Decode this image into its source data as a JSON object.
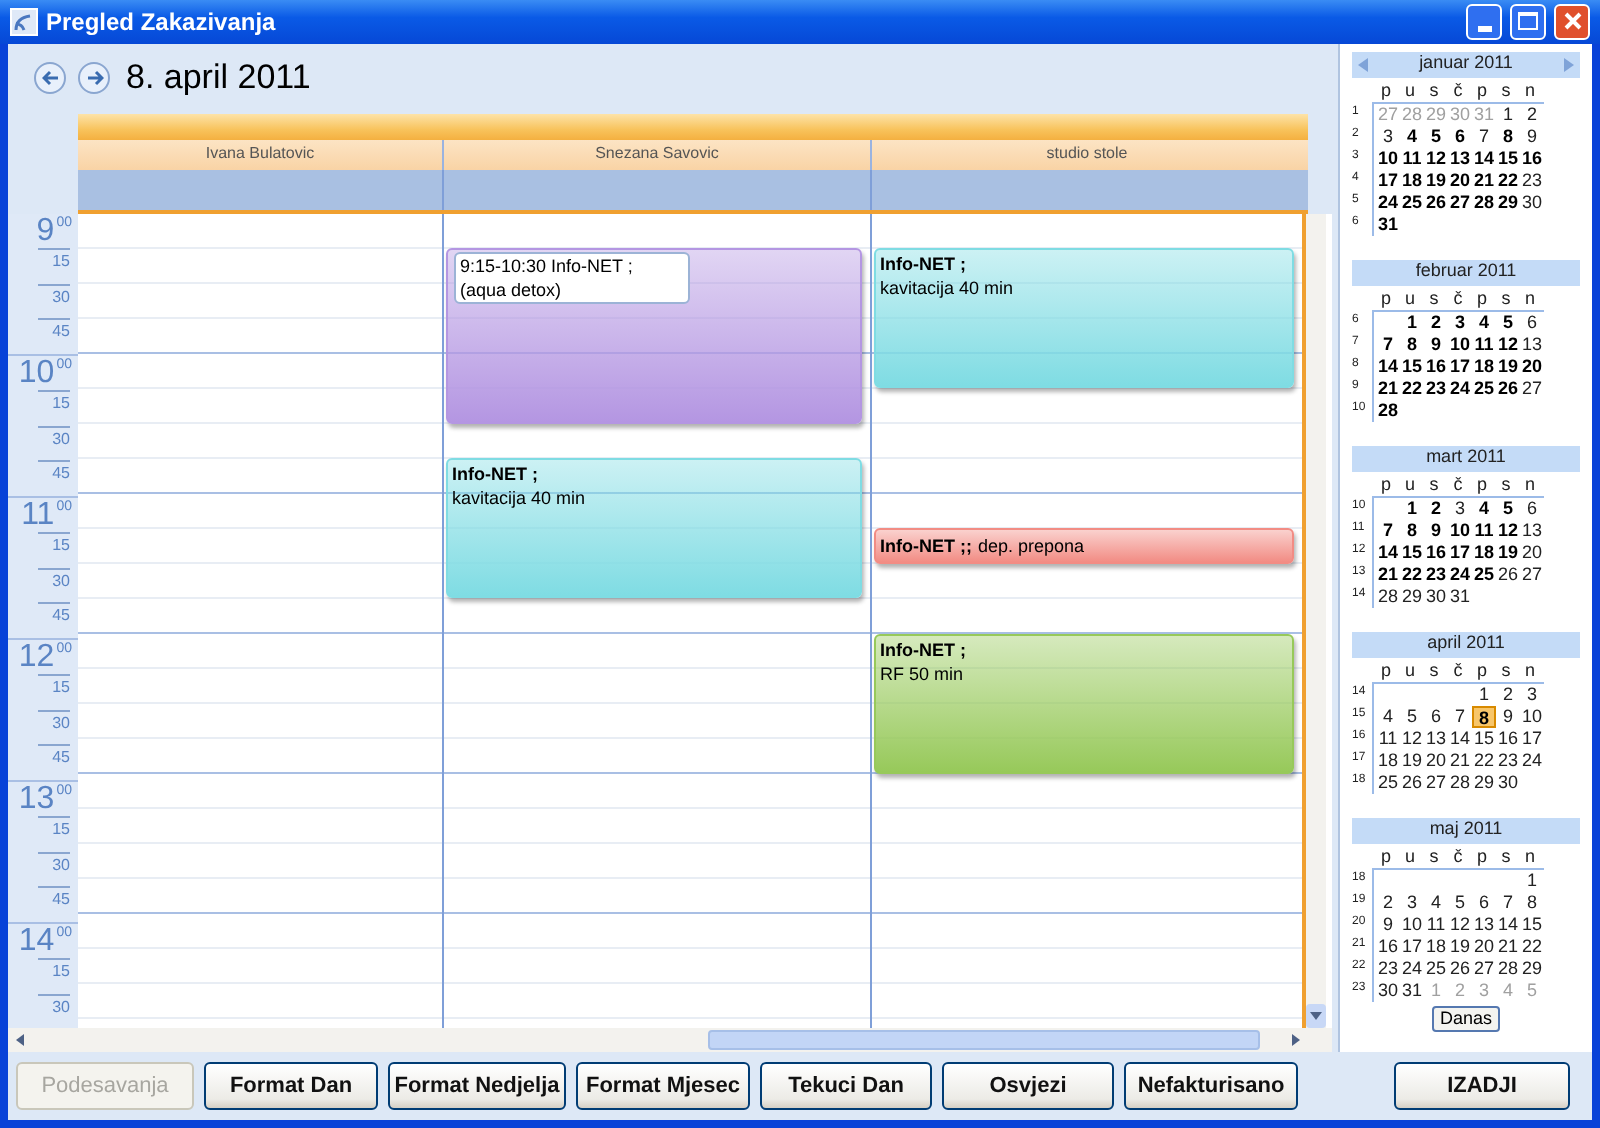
{
  "window": {
    "title": "Pregled Zakazivanja"
  },
  "date": "8. april 2011",
  "hours": [
    {
      "hour": "9",
      "minutes": "00",
      "quarters": [
        "15",
        "30",
        "45"
      ]
    },
    {
      "hour": "10",
      "minutes": "00",
      "quarters": [
        "15",
        "30",
        "45"
      ]
    },
    {
      "hour": "11",
      "minutes": "00",
      "quarters": [
        "15",
        "30",
        "45"
      ]
    },
    {
      "hour": "12",
      "minutes": "00",
      "quarters": [
        "15",
        "30",
        "45"
      ]
    },
    {
      "hour": "13",
      "minutes": "00",
      "quarters": [
        "15",
        "30",
        "45"
      ]
    },
    {
      "hour": "14",
      "minutes": "00",
      "quarters": [
        "15",
        "30"
      ]
    }
  ],
  "columns": [
    {
      "name": "Ivana Bulatovic"
    },
    {
      "name": "Snezana Savovic",
      "slots": [
        {
          "kind": "empty"
        },
        {
          "kind": "editing",
          "color": "#b496e2",
          "title": "9:15-10:30 Info-NET ;",
          "description": "(aqua detox)"
        },
        {
          "kind": "continued"
        },
        {
          "kind": "continued"
        },
        {
          "kind": "continued"
        },
        {
          "kind": "continued"
        },
        {
          "kind": "empty"
        },
        {
          "kind": "block",
          "color": "#7fdce3",
          "title": "Info-NET ;",
          "description": "kavitacija 40 min"
        },
        {
          "kind": "continued"
        },
        {
          "kind": "continued"
        },
        {
          "kind": "continued"
        }
      ]
    },
    {
      "name": "studio stole",
      "slots": [
        {
          "kind": "empty"
        },
        {
          "kind": "block",
          "color": "#7fdce3",
          "title": "Info-NET ;",
          "description": "kavitacija 40 min"
        },
        {
          "kind": "continued"
        },
        {
          "kind": "continued"
        },
        {
          "kind": "continued"
        },
        {
          "kind": "empty"
        },
        {
          "kind": "empty"
        },
        {
          "kind": "empty"
        },
        {
          "kind": "empty"
        },
        {
          "kind": "inline",
          "color": "#f28c84",
          "title": "Info-NET ;;",
          "description": "dep. prepona"
        },
        {
          "kind": "empty"
        },
        {
          "kind": "empty"
        },
        {
          "kind": "block",
          "color": "#97c95a",
          "title": "Info-NET ;",
          "description": "RF 50 min"
        },
        {
          "kind": "continued"
        },
        {
          "kind": "continued"
        },
        {
          "kind": "continued"
        }
      ]
    }
  ],
  "mini_calendars": [
    {
      "title": "januar 2011",
      "day_names": [
        "p",
        "u",
        "s",
        "č",
        "p",
        "s",
        "n"
      ],
      "weeks": [
        {
          "number": "1",
          "days": [
            {
              "d": "27",
              "kind": "other",
              "selected": false
            },
            {
              "d": "28",
              "kind": "other",
              "selected": false
            },
            {
              "d": "29",
              "kind": "other",
              "selected": false
            },
            {
              "d": "30",
              "kind": "other",
              "selected": false
            },
            {
              "d": "31",
              "kind": "other",
              "selected": false
            },
            {
              "d": "1",
              "kind": "free",
              "selected": false
            },
            {
              "d": "2",
              "kind": "free",
              "selected": false
            }
          ]
        },
        {
          "number": "2",
          "days": [
            {
              "d": "3",
              "kind": "free",
              "selected": false
            },
            {
              "d": "4",
              "kind": "busy",
              "selected": false
            },
            {
              "d": "5",
              "kind": "busy",
              "selected": false
            },
            {
              "d": "6",
              "kind": "busy",
              "selected": false
            },
            {
              "d": "7",
              "kind": "free",
              "selected": false
            },
            {
              "d": "8",
              "kind": "busy",
              "selected": false
            },
            {
              "d": "9",
              "kind": "free",
              "selected": false
            }
          ]
        },
        {
          "number": "3",
          "days": [
            {
              "d": "10",
              "kind": "busy",
              "selected": false
            },
            {
              "d": "11",
              "kind": "busy",
              "selected": false
            },
            {
              "d": "12",
              "kind": "busy",
              "selected": false
            },
            {
              "d": "13",
              "kind": "busy",
              "selected": false
            },
            {
              "d": "14",
              "kind": "busy",
              "selected": false
            },
            {
              "d": "15",
              "kind": "busy",
              "selected": false
            },
            {
              "d": "16",
              "kind": "busy",
              "selected": false
            }
          ]
        },
        {
          "number": "4",
          "days": [
            {
              "d": "17",
              "kind": "busy",
              "selected": false
            },
            {
              "d": "18",
              "kind": "busy",
              "selected": false
            },
            {
              "d": "19",
              "kind": "busy",
              "selected": false
            },
            {
              "d": "20",
              "kind": "busy",
              "selected": false
            },
            {
              "d": "21",
              "kind": "busy",
              "selected": false
            },
            {
              "d": "22",
              "kind": "busy",
              "selected": false
            },
            {
              "d": "23",
              "kind": "free",
              "selected": false
            }
          ]
        },
        {
          "number": "5",
          "days": [
            {
              "d": "24",
              "kind": "busy",
              "selected": false
            },
            {
              "d": "25",
              "kind": "busy",
              "selected": false
            },
            {
              "d": "26",
              "kind": "busy",
              "selected": false
            },
            {
              "d": "27",
              "kind": "busy",
              "selected": false
            },
            {
              "d": "28",
              "kind": "busy",
              "selected": false
            },
            {
              "d": "29",
              "kind": "busy",
              "selected": false
            },
            {
              "d": "30",
              "kind": "free",
              "selected": false
            }
          ]
        },
        {
          "number": "6",
          "days": [
            {
              "d": "31",
              "kind": "busy",
              "selected": false
            }
          ]
        }
      ]
    },
    {
      "title": "februar 2011",
      "day_names": [
        "p",
        "u",
        "s",
        "č",
        "p",
        "s",
        "n"
      ],
      "weeks": [
        {
          "number": "6",
          "days": [
            {
              "d": "1",
              "kind": "busy",
              "selected": false
            },
            {
              "d": "2",
              "kind": "busy",
              "selected": false
            },
            {
              "d": "3",
              "kind": "busy",
              "selected": false
            },
            {
              "d": "4",
              "kind": "busy",
              "selected": false
            },
            {
              "d": "5",
              "kind": "busy",
              "selected": false
            },
            {
              "d": "6",
              "kind": "free",
              "selected": false
            }
          ]
        },
        {
          "number": "7",
          "days": [
            {
              "d": "7",
              "kind": "busy",
              "selected": false
            },
            {
              "d": "8",
              "kind": "busy",
              "selected": false
            },
            {
              "d": "9",
              "kind": "busy",
              "selected": false
            },
            {
              "d": "10",
              "kind": "busy",
              "selected": false
            },
            {
              "d": "11",
              "kind": "busy",
              "selected": false
            },
            {
              "d": "12",
              "kind": "busy",
              "selected": false
            },
            {
              "d": "13",
              "kind": "free",
              "selected": false
            }
          ]
        },
        {
          "number": "8",
          "days": [
            {
              "d": "14",
              "kind": "busy",
              "selected": false
            },
            {
              "d": "15",
              "kind": "busy",
              "selected": false
            },
            {
              "d": "16",
              "kind": "busy",
              "selected": false
            },
            {
              "d": "17",
              "kind": "busy",
              "selected": false
            },
            {
              "d": "18",
              "kind": "busy",
              "selected": false
            },
            {
              "d": "19",
              "kind": "busy",
              "selected": false
            },
            {
              "d": "20",
              "kind": "busy",
              "selected": false
            }
          ]
        },
        {
          "number": "9",
          "days": [
            {
              "d": "21",
              "kind": "busy",
              "selected": false
            },
            {
              "d": "22",
              "kind": "busy",
              "selected": false
            },
            {
              "d": "23",
              "kind": "busy",
              "selected": false
            },
            {
              "d": "24",
              "kind": "busy",
              "selected": false
            },
            {
              "d": "25",
              "kind": "busy",
              "selected": false
            },
            {
              "d": "26",
              "kind": "busy",
              "selected": false
            },
            {
              "d": "27",
              "kind": "free",
              "selected": false
            }
          ]
        },
        {
          "number": "10",
          "days": [
            {
              "d": "28",
              "kind": "busy",
              "selected": false
            }
          ]
        }
      ]
    },
    {
      "title": "mart 2011",
      "day_names": [
        "p",
        "u",
        "s",
        "č",
        "p",
        "s",
        "n"
      ],
      "weeks": [
        {
          "number": "10",
          "days": [
            {
              "d": "1",
              "kind": "busy",
              "selected": false
            },
            {
              "d": "2",
              "kind": "busy",
              "selected": false
            },
            {
              "d": "3",
              "kind": "free",
              "selected": false
            },
            {
              "d": "4",
              "kind": "busy",
              "selected": false
            },
            {
              "d": "5",
              "kind": "busy",
              "selected": false
            },
            {
              "d": "6",
              "kind": "free",
              "selected": false
            }
          ]
        },
        {
          "number": "11",
          "days": [
            {
              "d": "7",
              "kind": "busy",
              "selected": false
            },
            {
              "d": "8",
              "kind": "busy",
              "selected": false
            },
            {
              "d": "9",
              "kind": "busy",
              "selected": false
            },
            {
              "d": "10",
              "kind": "busy",
              "selected": false
            },
            {
              "d": "11",
              "kind": "busy",
              "selected": false
            },
            {
              "d": "12",
              "kind": "busy",
              "selected": false
            },
            {
              "d": "13",
              "kind": "free",
              "selected": false
            }
          ]
        },
        {
          "number": "12",
          "days": [
            {
              "d": "14",
              "kind": "busy",
              "selected": false
            },
            {
              "d": "15",
              "kind": "busy",
              "selected": false
            },
            {
              "d": "16",
              "kind": "busy",
              "selected": false
            },
            {
              "d": "17",
              "kind": "busy",
              "selected": false
            },
            {
              "d": "18",
              "kind": "busy",
              "selected": false
            },
            {
              "d": "19",
              "kind": "busy",
              "selected": false
            },
            {
              "d": "20",
              "kind": "free",
              "selected": false
            }
          ]
        },
        {
          "number": "13",
          "days": [
            {
              "d": "21",
              "kind": "busy",
              "selected": false
            },
            {
              "d": "22",
              "kind": "busy",
              "selected": false
            },
            {
              "d": "23",
              "kind": "busy",
              "selected": false
            },
            {
              "d": "24",
              "kind": "busy",
              "selected": false
            },
            {
              "d": "25",
              "kind": "busy",
              "selected": false
            },
            {
              "d": "26",
              "kind": "free",
              "selected": false
            },
            {
              "d": "27",
              "kind": "free",
              "selected": false
            }
          ]
        },
        {
          "number": "14",
          "days": [
            {
              "d": "28",
              "kind": "free",
              "selected": false
            },
            {
              "d": "29",
              "kind": "free",
              "selected": false
            },
            {
              "d": "30",
              "kind": "free",
              "selected": false
            },
            {
              "d": "31",
              "kind": "free",
              "selected": false
            }
          ]
        }
      ]
    },
    {
      "title": "april 2011",
      "day_names": [
        "p",
        "u",
        "s",
        "č",
        "p",
        "s",
        "n"
      ],
      "weeks": [
        {
          "number": "14",
          "days": [
            {
              "d": "1",
              "kind": "free",
              "selected": false
            },
            {
              "d": "2",
              "kind": "free",
              "selected": false
            },
            {
              "d": "3",
              "kind": "free",
              "selected": false
            }
          ]
        },
        {
          "number": "15",
          "days": [
            {
              "d": "4",
              "kind": "free",
              "selected": false
            },
            {
              "d": "5",
              "kind": "free",
              "selected": false
            },
            {
              "d": "6",
              "kind": "free",
              "selected": false
            },
            {
              "d": "7",
              "kind": "free",
              "selected": false
            },
            {
              "d": "8",
              "kind": "busy",
              "selected": true
            },
            {
              "d": "9",
              "kind": "free",
              "selected": false
            },
            {
              "d": "10",
              "kind": "free",
              "selected": false
            }
          ]
        },
        {
          "number": "16",
          "days": [
            {
              "d": "11",
              "kind": "free",
              "selected": false
            },
            {
              "d": "12",
              "kind": "free",
              "selected": false
            },
            {
              "d": "13",
              "kind": "free",
              "selected": false
            },
            {
              "d": "14",
              "kind": "free",
              "selected": false
            },
            {
              "d": "15",
              "kind": "free",
              "selected": false
            },
            {
              "d": "16",
              "kind": "free",
              "selected": false
            },
            {
              "d": "17",
              "kind": "free",
              "selected": false
            }
          ]
        },
        {
          "number": "17",
          "days": [
            {
              "d": "18",
              "kind": "free",
              "selected": false
            },
            {
              "d": "19",
              "kind": "free",
              "selected": false
            },
            {
              "d": "20",
              "kind": "free",
              "selected": false
            },
            {
              "d": "21",
              "kind": "free",
              "selected": false
            },
            {
              "d": "22",
              "kind": "free",
              "selected": false
            },
            {
              "d": "23",
              "kind": "free",
              "selected": false
            },
            {
              "d": "24",
              "kind": "free",
              "selected": false
            }
          ]
        },
        {
          "number": "18",
          "days": [
            {
              "d": "25",
              "kind": "free",
              "selected": false
            },
            {
              "d": "26",
              "kind": "free",
              "selected": false
            },
            {
              "d": "27",
              "kind": "free",
              "selected": false
            },
            {
              "d": "28",
              "kind": "free",
              "selected": false
            },
            {
              "d": "29",
              "kind": "free",
              "selected": false
            },
            {
              "d": "30",
              "kind": "free",
              "selected": false
            }
          ]
        }
      ]
    },
    {
      "title": "maj 2011",
      "day_names": [
        "p",
        "u",
        "s",
        "č",
        "p",
        "s",
        "n"
      ],
      "weeks": [
        {
          "number": "18",
          "days": [
            {
              "d": "1",
              "kind": "free",
              "selected": false
            }
          ]
        },
        {
          "number": "19",
          "days": [
            {
              "d": "2",
              "kind": "free",
              "selected": false
            },
            {
              "d": "3",
              "kind": "free",
              "selected": false
            },
            {
              "d": "4",
              "kind": "free",
              "selected": false
            },
            {
              "d": "5",
              "kind": "free",
              "selected": false
            },
            {
              "d": "6",
              "kind": "free",
              "selected": false
            },
            {
              "d": "7",
              "kind": "free",
              "selected": false
            },
            {
              "d": "8",
              "kind": "free",
              "selected": false
            }
          ]
        },
        {
          "number": "20",
          "days": [
            {
              "d": "9",
              "kind": "free",
              "selected": false
            },
            {
              "d": "10",
              "kind": "free",
              "selected": false
            },
            {
              "d": "11",
              "kind": "free",
              "selected": false
            },
            {
              "d": "12",
              "kind": "free",
              "selected": false
            },
            {
              "d": "13",
              "kind": "free",
              "selected": false
            },
            {
              "d": "14",
              "kind": "free",
              "selected": false
            },
            {
              "d": "15",
              "kind": "free",
              "selected": false
            }
          ]
        },
        {
          "number": "21",
          "days": [
            {
              "d": "16",
              "kind": "free",
              "selected": false
            },
            {
              "d": "17",
              "kind": "free",
              "selected": false
            },
            {
              "d": "18",
              "kind": "free",
              "selected": false
            },
            {
              "d": "19",
              "kind": "free",
              "selected": false
            },
            {
              "d": "20",
              "kind": "free",
              "selected": false
            },
            {
              "d": "21",
              "kind": "free",
              "selected": false
            },
            {
              "d": "22",
              "kind": "free",
              "selected": false
            }
          ]
        },
        {
          "number": "22",
          "days": [
            {
              "d": "23",
              "kind": "free",
              "selected": false
            },
            {
              "d": "24",
              "kind": "free",
              "selected": false
            },
            {
              "d": "25",
              "kind": "free",
              "selected": false
            },
            {
              "d": "26",
              "kind": "free",
              "selected": false
            },
            {
              "d": "27",
              "kind": "free",
              "selected": false
            },
            {
              "d": "28",
              "kind": "free",
              "selected": false
            },
            {
              "d": "29",
              "kind": "free",
              "selected": false
            }
          ]
        },
        {
          "number": "23",
          "days": [
            {
              "d": "30",
              "kind": "free",
              "selected": false
            },
            {
              "d": "31",
              "kind": "free",
              "selected": false
            },
            {
              "d": "1",
              "kind": "other",
              "selected": false
            },
            {
              "d": "2",
              "kind": "other",
              "selected": false
            },
            {
              "d": "3",
              "kind": "other",
              "selected": false
            },
            {
              "d": "4",
              "kind": "other",
              "selected": false
            },
            {
              "d": "5",
              "kind": "other",
              "selected": false
            }
          ]
        }
      ]
    }
  ],
  "today_button": "Danas",
  "buttons": [
    {
      "label": "Podesavanja",
      "disabled": true
    },
    {
      "label": "Format Dan",
      "disabled": false
    },
    {
      "label": "Format Nedjelja",
      "disabled": false
    },
    {
      "label": "Format Mjesec",
      "disabled": false
    },
    {
      "label": "Tekuci Dan",
      "disabled": false
    },
    {
      "label": "Osvjezi",
      "disabled": false
    },
    {
      "label": "Nefakturisano",
      "disabled": false
    },
    {
      "label": "IZADJI",
      "disabled": false
    }
  ]
}
